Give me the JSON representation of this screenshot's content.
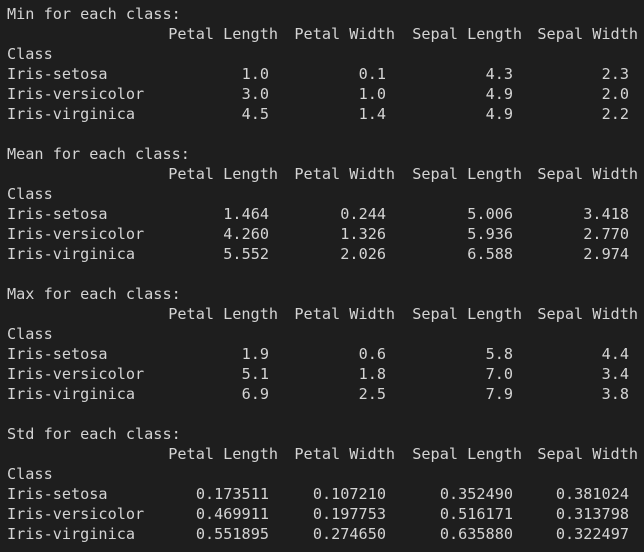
{
  "headers": [
    "Petal Length",
    "Petal Width",
    "Sepal Length",
    "Sepal Width"
  ],
  "index_label": "Class",
  "sections": [
    {
      "title": "Min for each class:",
      "rows": [
        {
          "class": "Iris-setosa",
          "values": [
            "1.0",
            "0.1",
            "4.3",
            "2.3"
          ]
        },
        {
          "class": "Iris-versicolor",
          "values": [
            "3.0",
            "1.0",
            "4.9",
            "2.0"
          ]
        },
        {
          "class": "Iris-virginica",
          "values": [
            "4.5",
            "1.4",
            "4.9",
            "2.2"
          ]
        }
      ]
    },
    {
      "title": "Mean for each class:",
      "rows": [
        {
          "class": "Iris-setosa",
          "values": [
            "1.464",
            "0.244",
            "5.006",
            "3.418"
          ]
        },
        {
          "class": "Iris-versicolor",
          "values": [
            "4.260",
            "1.326",
            "5.936",
            "2.770"
          ]
        },
        {
          "class": "Iris-virginica",
          "values": [
            "5.552",
            "2.026",
            "6.588",
            "2.974"
          ]
        }
      ]
    },
    {
      "title": "Max for each class:",
      "rows": [
        {
          "class": "Iris-setosa",
          "values": [
            "1.9",
            "0.6",
            "5.8",
            "4.4"
          ]
        },
        {
          "class": "Iris-versicolor",
          "values": [
            "5.1",
            "1.8",
            "7.0",
            "3.4"
          ]
        },
        {
          "class": "Iris-virginica",
          "values": [
            "6.9",
            "2.5",
            "7.9",
            "3.8"
          ]
        }
      ]
    },
    {
      "title": "Std for each class:",
      "rows": [
        {
          "class": "Iris-setosa",
          "values": [
            "0.173511",
            "0.107210",
            "0.352490",
            "0.381024"
          ]
        },
        {
          "class": "Iris-versicolor",
          "values": [
            "0.469911",
            "0.197753",
            "0.516171",
            "0.313798"
          ]
        },
        {
          "class": "Iris-virginica",
          "values": [
            "0.551895",
            "0.274650",
            "0.635880",
            "0.322497"
          ]
        }
      ]
    }
  ]
}
